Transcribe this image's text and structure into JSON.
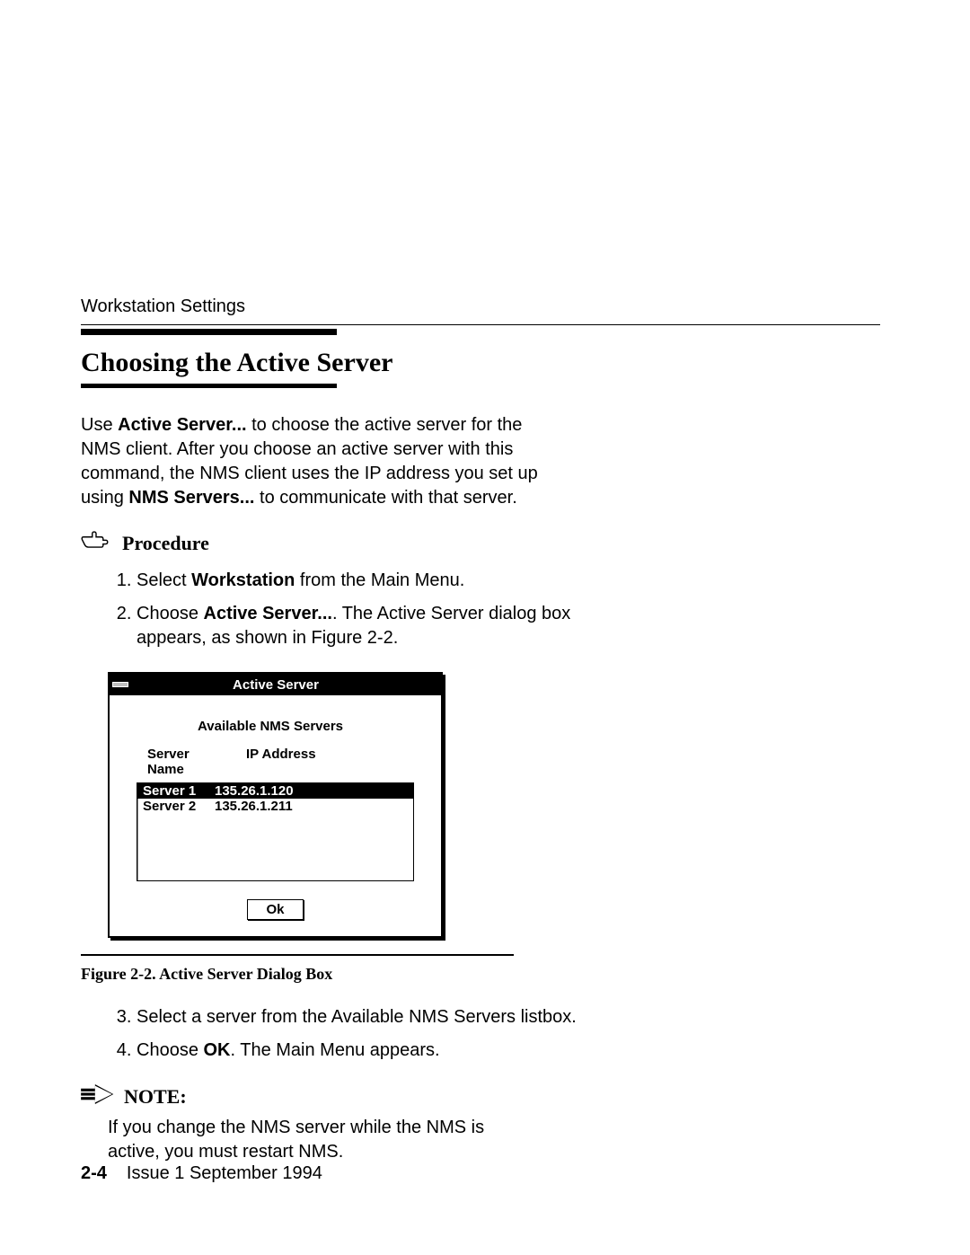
{
  "header": {
    "running": "Workstation Settings"
  },
  "section": {
    "title": "Choosing the Active Server",
    "intro_pre": "Use ",
    "intro_b1": "Active Server...",
    "intro_mid": " to choose the active server for the NMS client. After you choose an active server with this command, the NMS client uses the IP address you set up using ",
    "intro_b2": "NMS Servers...",
    "intro_post": " to communicate with that server."
  },
  "procedure": {
    "label": "Procedure",
    "steps": {
      "s1_pre": "Select ",
      "s1_b": "Workstation",
      "s1_post": " from the Main Menu.",
      "s2_pre": "Choose ",
      "s2_b": "Active Server...",
      "s2_post": ". The Active Server dialog box appears, as shown in Figure 2-2.",
      "s3": "Select a server from the Available NMS Servers listbox.",
      "s4_pre": "Choose ",
      "s4_b": "OK",
      "s4_post": ". The Main Menu appears."
    }
  },
  "dialog": {
    "title": "Active Server",
    "available_label": "Available NMS Servers",
    "col_server": "Server Name",
    "col_ip": "IP Address",
    "rows": [
      {
        "name": "Server 1",
        "ip": "135.26.1.120",
        "selected": true
      },
      {
        "name": "Server 2",
        "ip": "135.26.1.211",
        "selected": false
      }
    ],
    "ok": "Ok"
  },
  "figure": {
    "caption": "Figure 2-2.  Active Server Dialog Box"
  },
  "note": {
    "label": "NOTE:",
    "text": "If you change the NMS server while the NMS is active, you must restart NMS."
  },
  "footer": {
    "page": "2-4",
    "issue": "Issue 1  September 1994"
  }
}
